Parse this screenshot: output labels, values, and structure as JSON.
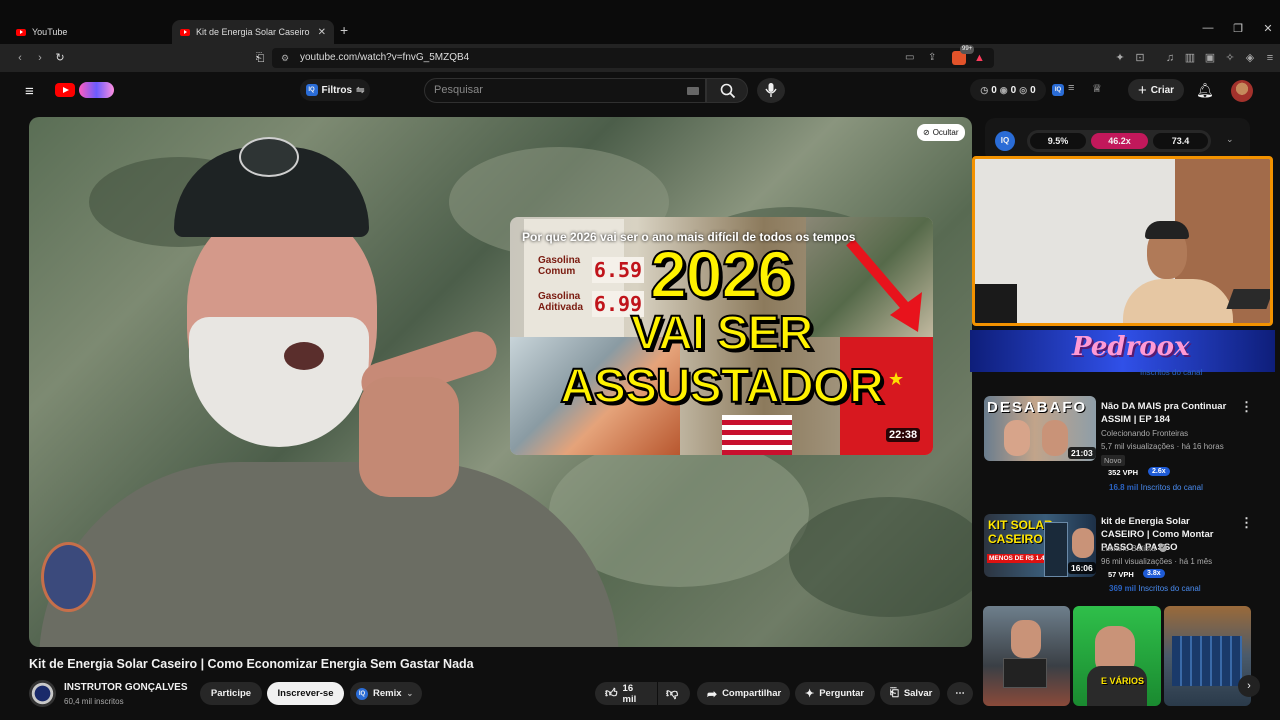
{
  "tabs": [
    {
      "label": "YouTube"
    },
    {
      "label": "Kit de Energia Solar Caseiro | Co"
    }
  ],
  "browser": {
    "url": "youtube.com/watch?v=fnvG_5MZQB4",
    "ext_badge": "99+"
  },
  "header": {
    "filters_label": "Filtros",
    "search_placeholder": "Pesquisar",
    "counter_a": "0",
    "counter_b": "0",
    "counter_c": "0",
    "create_label": "Criar"
  },
  "player": {
    "hide_label": "Ocultar",
    "endcard": {
      "title": "Por que 2026 vai ser o ano mais difícil de todos os tempos",
      "line1": "2026",
      "line2": "VAI SER",
      "line3": "ASSUSTADOR",
      "duration": "22:38",
      "sign_a": "Gasolina\nComum",
      "sign_b": "Gasolina\nAditivada",
      "price_a": "6.59",
      "price_b": "6.99"
    }
  },
  "stats": {
    "a": "9.5%",
    "b": "46.2x",
    "c": "73.4"
  },
  "overlay_text": "Pedroox",
  "overlay_sub": "Inscritos do canal",
  "recommendations": [
    {
      "thumb_text": "DESABAFO",
      "title": "Não DA MAIS pra Continuar ASSIM | EP 184",
      "channel": "Colecionando Fronteiras",
      "meta": "5,7 mil visualizações · há 16 horas",
      "tag": "Novo",
      "duration": "21:03",
      "vph": "352 VPH",
      "mult": "2.6x",
      "subs_num": "16.8 mil",
      "subs_label": "Inscritos do canal"
    },
    {
      "thumb_text": "KIT SOLAR\nCASEIRO",
      "thumb_sub": "MENOS DE R$ 1.400",
      "title": "kit de Energia Solar CASEIRO | Como Montar PASSO A PASSO",
      "channel": "Luciano Batista",
      "meta": "96 mil visualizações · há 1 mês",
      "duration": "16:06",
      "vph": "57 VPH",
      "mult": "3.8x",
      "subs_num": "369 mil",
      "subs_label": "Inscritos do canal"
    }
  ],
  "shorts": [
    {
      "label": ""
    },
    {
      "label": "E VÁRIOS"
    },
    {
      "label": ""
    }
  ],
  "video": {
    "title": "Kit de Energia Solar Caseiro | Como Economizar Energia Sem Gastar Nada",
    "channel": "INSTRUTOR GONÇALVES",
    "subscribers": "60,4 mil inscritos",
    "join_label": "Participe",
    "subscribe_label": "Inscrever-se",
    "remix_label": "Remix",
    "likes": "16 mil",
    "share_label": "Compartilhar",
    "ask_label": "Perguntar",
    "save_label": "Salvar"
  }
}
